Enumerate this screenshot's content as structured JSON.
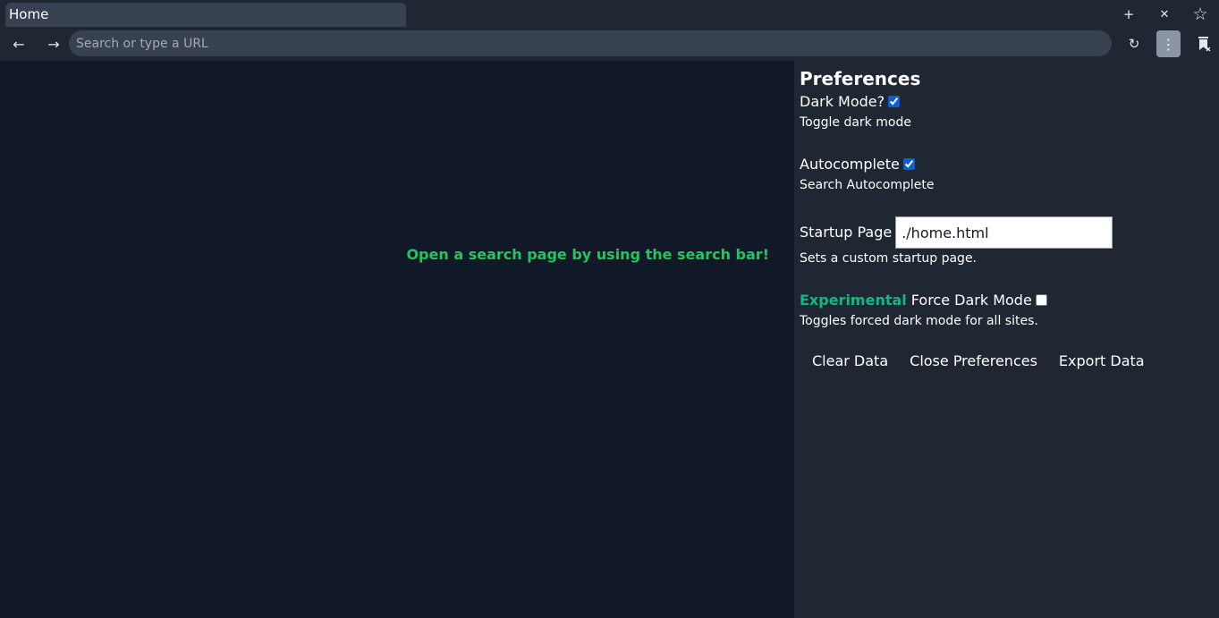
{
  "tab": {
    "title": "Home"
  },
  "tabbar": {
    "new_tab": "+",
    "close_tab": "✕",
    "bookmark": "☆"
  },
  "toolbar": {
    "back": "←",
    "forward": "→",
    "search_placeholder": "Search or type a URL",
    "search_value": "",
    "reload": "↻",
    "menu": "⋮"
  },
  "content": {
    "message": "Open a search page by using the search bar!"
  },
  "preferences": {
    "title": "Preferences",
    "dark_mode": {
      "label": "Dark Mode?",
      "checked": true,
      "description": "Toggle dark mode"
    },
    "autocomplete": {
      "label": "Autocomplete",
      "checked": true,
      "description": "Search Autocomplete"
    },
    "startup": {
      "label": "Startup Page",
      "value": "./home.html",
      "description": "Sets a custom startup page."
    },
    "force_dark": {
      "tag": "Experimental",
      "label": "Force Dark Mode",
      "checked": false,
      "description": "Toggles forced dark mode for all sites."
    },
    "actions": {
      "clear": "Clear Data",
      "close": "Close Preferences",
      "export": "Export Data"
    }
  },
  "colors": {
    "accent_green": "#22c55e",
    "experimental_green": "#10b981",
    "content_bg": "#111827",
    "panel_bg": "#1f2733"
  }
}
